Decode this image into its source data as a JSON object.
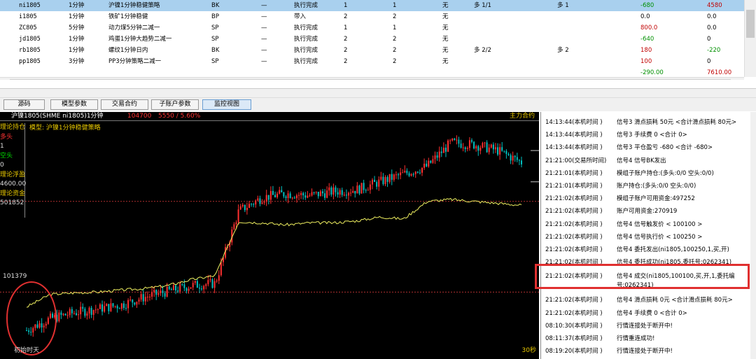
{
  "table": {
    "rows": [
      {
        "code": "ni1805",
        "period": "1分钟",
        "strategy": "沪镍1分钟稳健策略",
        "type": "BK",
        "dash": "—",
        "status": "执行完成",
        "a": "1",
        "b": "1",
        "flag": "无",
        "s1": "多 1/1",
        "s2": "多 1",
        "v1": "-680",
        "v1c": "neg",
        "v2": "4580",
        "v2c": "pos",
        "selected": true
      },
      {
        "code": "i1805",
        "period": "1分钟",
        "strategy": "铁矿1分钟稳健",
        "type": "BP",
        "dash": "—",
        "status": "带入",
        "a": "2",
        "b": "2",
        "flag": "无",
        "s1": "",
        "s2": "",
        "v1": "0.0",
        "v1c": "zero",
        "v2": "0.0",
        "v2c": "zero"
      },
      {
        "code": "ZC805",
        "period": "5分钟",
        "strategy": "动力煤5分钟二减一",
        "type": "SP",
        "dash": "—",
        "status": "执行完成",
        "a": "1",
        "b": "1",
        "flag": "无",
        "s1": "",
        "s2": "",
        "v1": "800.0",
        "v1c": "pos",
        "v2": "0.0",
        "v2c": "zero"
      },
      {
        "code": "jd1805",
        "period": "1分钟",
        "strategy": "鸡蛋1分钟大趋势二减一",
        "type": "SP",
        "dash": "—",
        "status": "执行完成",
        "a": "2",
        "b": "2",
        "flag": "无",
        "s1": "",
        "s2": "",
        "v1": "-640",
        "v1c": "neg",
        "v2": "0",
        "v2c": "zero"
      },
      {
        "code": "rb1805",
        "period": "1分钟",
        "strategy": "螺纹1分钟日内",
        "type": "BK",
        "dash": "—",
        "status": "执行完成",
        "a": "2",
        "b": "2",
        "flag": "无",
        "s1": "多 2/2",
        "s2": "多 2",
        "v1": "180",
        "v1c": "pos",
        "v2": "-220",
        "v2c": "neg"
      },
      {
        "code": "pp1805",
        "period": "3分钟",
        "strategy": "PP3分钟策略二减一",
        "type": "SP",
        "dash": "—",
        "status": "执行完成",
        "a": "2",
        "b": "2",
        "flag": "无",
        "s1": "",
        "s2": "",
        "v1": "100",
        "v1c": "pos",
        "v2": "0",
        "v2c": "zero"
      }
    ],
    "totals": {
      "v1": "-290.00",
      "v2": "7610.00"
    }
  },
  "tabs": [
    {
      "key": "source",
      "label": "源码"
    },
    {
      "key": "model",
      "label": "模型参数"
    },
    {
      "key": "trade",
      "label": "交易合约"
    },
    {
      "key": "sub",
      "label": "子账户参数"
    },
    {
      "key": "monitor",
      "label": "监控视图",
      "active": true
    }
  ],
  "chart_header": {
    "symbol": "沪镍1805(SHME ni1805)1分钟",
    "price": "104700",
    "change": "5550 / 5.60%",
    "main_contract": "主力合约"
  },
  "model_label": "模型: 沪镍1分钟稳健策略",
  "left_panel": {
    "pos_title": "理论持仓",
    "long_label": "多头",
    "long_value": "1",
    "short_label": "空头",
    "short_value": "0",
    "float_title": "理论浮盈",
    "float_value": "4600.00",
    "fund_title": "理论资金",
    "fund_value": "501852"
  },
  "ref_price": "101379",
  "init_label": "初始时天",
  "period_label": "30秒",
  "colors": {
    "up_candle": "#ff3030",
    "down_candle": "#00c0c0",
    "equity_line": "#f0f060",
    "dotted_line": "#b03030",
    "highlight_box": "#e03030"
  },
  "chart_data": {
    "type": "line",
    "series": [
      {
        "values": [
          100400,
          100700,
          100850,
          100950,
          101050,
          101250,
          101400,
          101550,
          101600,
          103450,
          103800,
          103900,
          103850,
          103950,
          104000,
          104200,
          104400,
          104600,
          105200,
          105150,
          105000,
          104700
        ]
      },
      {
        "values": [
          101000,
          101320,
          101360,
          101380,
          101430,
          101470,
          101550,
          101700,
          101800,
          103180,
          103150,
          103100,
          103150,
          103150,
          103200,
          103300,
          103250,
          103700,
          103750,
          103700,
          103650,
          103600
        ]
      }
    ],
    "ref_lines": [
      101379,
      103700
    ]
  },
  "log": [
    {
      "time": "14:13:44(本机时间  )",
      "msg": "信号3 滑点损耗 50元 <合计滑点损耗 80元>"
    },
    {
      "time": "14:13:44(本机时间  )",
      "msg": "信号3 手续费 0 <合计 0>"
    },
    {
      "time": "14:13:44(本机时间  )",
      "msg": "信号3 平仓盈亏 -680 <合计 -680>"
    },
    {
      "time": "21:21:00(交易所时间)",
      "msg": "信号4 信号BK发出"
    },
    {
      "time": "21:21:01(本机时间  )",
      "msg": "模组子账户持仓:(多头:0/0 空头:0/0)"
    },
    {
      "time": "21:21:01(本机时间  )",
      "msg": "账户持仓:(多头:0/0 空头:0/0)"
    },
    {
      "time": "21:21:02(本机时间  )",
      "msg": "模组子账户可用资金:497252"
    },
    {
      "time": "21:21:02(本机时间  )",
      "msg": "账户可用资金:270919"
    },
    {
      "time": "21:21:02(本机时间  )",
      "msg": "信号4 信号触发价 < 100100 >"
    },
    {
      "time": "21:21:02(本机时间  )",
      "msg": "信号4 信号执行价 < 100250 >"
    },
    {
      "time": "21:21:02(本机时间  )",
      "msg": "信号4 委托发出(ni1805,100250,1,买,开)"
    },
    {
      "time": "21:21:02(本机时间  )",
      "msg": "信号4 委托成功(ni1805,委托号:0262341)"
    },
    {
      "time": "21:21:02(本机时间  )",
      "msg": "信号4 成交(ni1805,100100,买,开,1,委托编号:0262341)",
      "highlight": true
    },
    {
      "time": "21:21:02(本机时间  )",
      "msg": "信号4 滑点损耗 0元 <合计滑点损耗 80元>"
    },
    {
      "time": "21:21:02(本机时间  )",
      "msg": "信号4 手续费 0 <合计 0>"
    },
    {
      "time": "08:10:30(本机时间  )",
      "msg": "行情连接处于断开中!"
    },
    {
      "time": "08:11:37(本机时间  )",
      "msg": "行情重连成功!"
    },
    {
      "time": "08:19:20(本机时间  )",
      "msg": "行情连接处于断开中!"
    }
  ]
}
